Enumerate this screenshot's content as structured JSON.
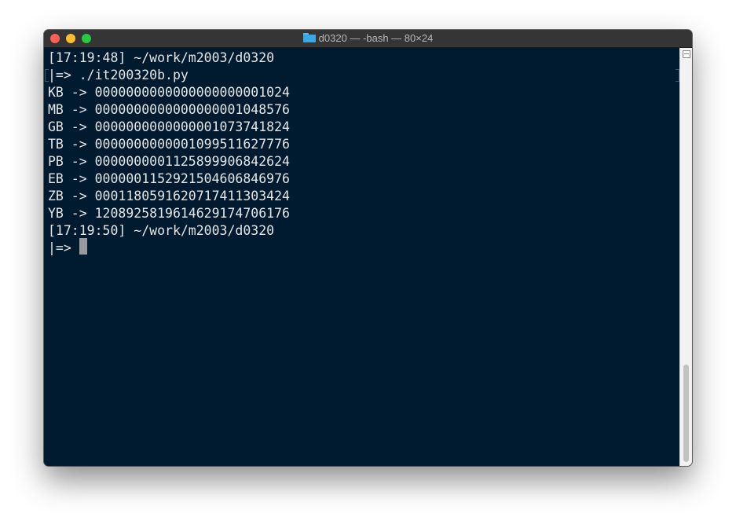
{
  "window": {
    "title": "d0320 — -bash — 80×24",
    "background": "#001b30",
    "text_color": "#e6e6e6"
  },
  "terminal": {
    "lines": [
      "[17:19:48] ~/work/m2003/d0320",
      "|=> ./it200320b.py",
      "KB -> 0000000000000000000001024",
      "MB -> 0000000000000000001048576",
      "GB -> 0000000000000001073741824",
      "TB -> 0000000000001099511627776",
      "PB -> 0000000001125899906842624",
      "EB -> 0000001152921504606846976",
      "ZB -> 0001180591620717411303424",
      "YB -> 1208925819614629174706176",
      "[17:19:50] ~/work/m2003/d0320",
      "|=> "
    ]
  },
  "icons": {
    "title_icon": "folder-icon",
    "scroll_button": "split-pane-icon"
  }
}
